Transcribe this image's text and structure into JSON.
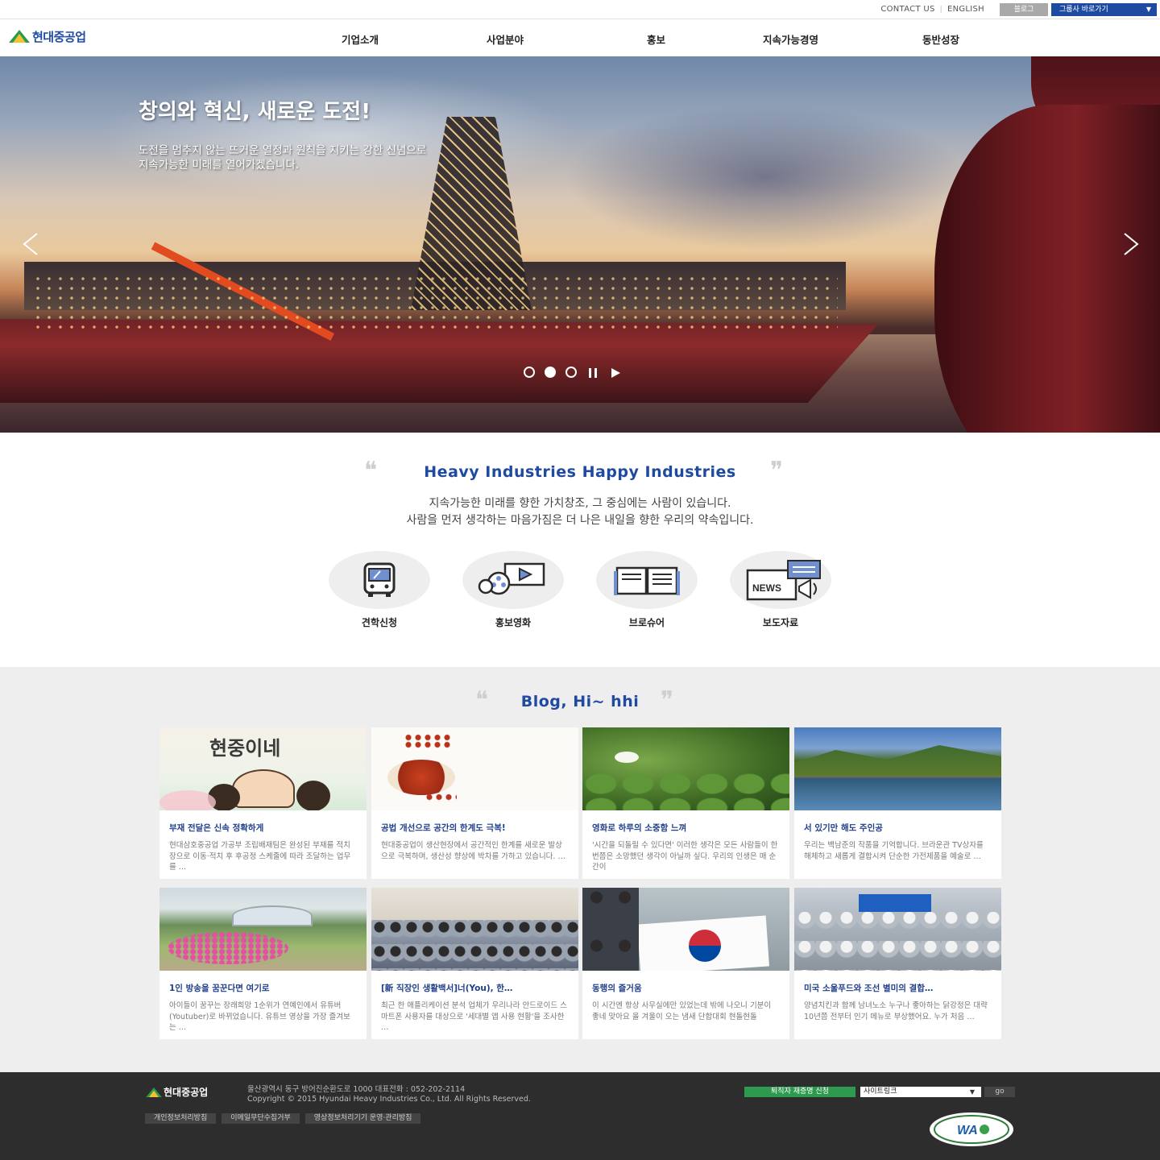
{
  "util": {
    "contact": "CONTACT US",
    "english": "ENGLISH",
    "blog": "블로그",
    "group": "그룹사 바로가기"
  },
  "header": {
    "logo": "현대중공업",
    "nav": [
      "기업소개",
      "사업분야",
      "홍보",
      "지속가능경영",
      "동반성장"
    ]
  },
  "hero": {
    "title": "창의와 혁신, 새로운 도전!",
    "subtitle_line1": "도전을 멈추지 않는 뜨거운 열정과 원칙을 지키는 강한 신념으로",
    "subtitle_line2": "지속가능한 미래를 열어가겠습니다.",
    "active_slide": 2,
    "slide_count": 3
  },
  "intro": {
    "title": "Heavy Industries Happy Industries",
    "line1": "지속가능한 미래를 향한 가치창조, 그 중심에는 사람이 있습니다.",
    "line2": "사람을 먼저 생각하는 마음가짐은 더 나은 내일을 향한 우리의 약속입니다."
  },
  "quick_links": [
    {
      "label": "견학신청",
      "icon": "bus-icon"
    },
    {
      "label": "홍보영화",
      "icon": "film-projector-icon"
    },
    {
      "label": "브로슈어",
      "icon": "brochure-book-icon"
    },
    {
      "label": "보도자료",
      "icon": "news-megaphone-icon"
    }
  ],
  "blog": {
    "title": "Blog, Hi~ hhi",
    "posts": [
      {
        "title": "부재 전달은 신속 정확하게",
        "desc": "현대삼호중공업 가공부 조립배재팀은 완성된 부재를 적치장으로 이동·적치 후 후공정 스케줄에 따라 조달하는 업무를 …"
      },
      {
        "title": "공법 개선으로 공간의 한계도 극복!",
        "desc": "현대중공업이 생산현장에서 공간적인 한계를 새로운 발상으로 극복하며, 생산성 향상에 박차를 가하고 있습니다. …"
      },
      {
        "title": "영화로 하루의 소중함 느껴",
        "desc": "'시간을 되돌릴 수 있다면' 이러한 생각은 모든 사람들이 한 번쯤은 소망했던 생각이 아닐까 싶다. 우리의 인생은 매 순간이"
      },
      {
        "title": "서 있기만 해도 주인공",
        "desc": "우리는 백남준의 작품을 기억합니다. 브라운관 TV상자를 해체하고 새롭게 결합시켜 단순한 가전제품을 예술로 …"
      },
      {
        "title": "1인 방송을 꿈꾼다면 여기로",
        "desc": "아이들이 꿈꾸는 장래희망 1순위가 연예인에서 유튜버(Youtuber)로 바뀌었습니다. 유튜브 영상을 가장 즐겨보는 …"
      },
      {
        "title": "[新 직장인 생활백서]너(You), 한…",
        "desc": "최근 한 애플리케이션 분석 업체가 우리나라 안드로이드 스마트폰 사용자를 대상으로 '세대별 앱 사용 현황'을 조사한 …"
      },
      {
        "title": "동행의 즐거움",
        "desc": "이 시간엔 항상 사무실에만 있었는데 밖에 나오니 기분이 좋네 맞아요 올 겨울이 오는 냄새 단합대회 현돌현돌"
      },
      {
        "title": "미국 소울푸드와 조선 별미의 결합…",
        "desc": "양념치킨과 함께 남녀노소 누구나 좋아하는 닭강정은 대략 10년쯤 전부터 인기 메뉴로 부상했어요. 누가 처음 …"
      }
    ],
    "thumb_labels": [
      "현중이네",
      "동행의 즐거움"
    ]
  },
  "footer": {
    "logo": "현대중공업",
    "address": "울산광역시 동구 방어진순환도로 1000 대표전화 : 052-202-2114",
    "copyright": "Copyright © 2015 Hyundai Heavy Industries Co., Ltd. All Rights Reserved.",
    "links": [
      "개인정보처리방침",
      "이메일무단수집거부",
      "영상정보처리기기 운영·관리방침"
    ],
    "cert_button": "퇴직자 재증명 신청",
    "site_link": "사이트링크",
    "go": "go",
    "badge": "WA"
  },
  "colors": {
    "brand_blue": "#1f4aa1",
    "brand_green": "#2e9a4f",
    "footer_bg": "#2d2d2d"
  }
}
